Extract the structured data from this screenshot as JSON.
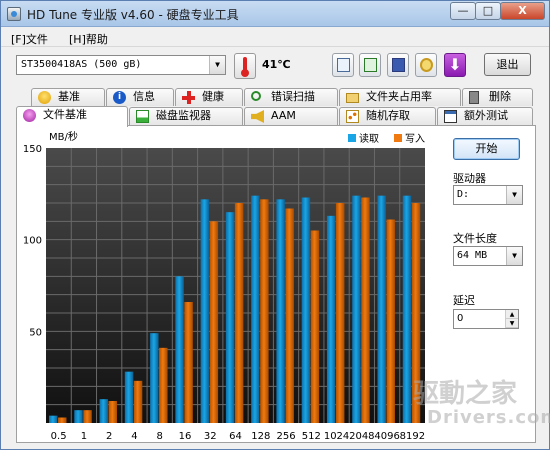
{
  "window": {
    "title": "HD Tune 专业版 v4.60 - 硬盘专业工具",
    "min_label": "—",
    "max_label": "□",
    "close_label": "X"
  },
  "menu": {
    "file": "[F]文件",
    "help": "[H]帮助"
  },
  "toolbar": {
    "drive": "ST3500418AS (500 gB)",
    "temperature": "41℃",
    "exit_label": "退出",
    "download_glyph": "⬇"
  },
  "tabs": {
    "row1": [
      "基准",
      "信息",
      "健康",
      "错误扫描",
      "文件夹占用率",
      "删除"
    ],
    "row2": [
      "文件基准",
      "磁盘监视器",
      "AAM",
      "随机存取",
      "额外测试"
    ],
    "active": "文件基准"
  },
  "side": {
    "start_label": "开始",
    "drive_label": "驱动器",
    "drive_value": "D:",
    "length_label": "文件长度",
    "length_value": "64 MB",
    "delay_label": "延迟",
    "delay_value": "0"
  },
  "colors": {
    "read": "#1aa6e6",
    "write": "#f07a10",
    "background_top": "#4a4a4a",
    "background_bottom": "#101010"
  },
  "chart_data": {
    "type": "bar",
    "ylabel": "MB/秒",
    "ylim": [
      0,
      150
    ],
    "yticks": [
      50,
      100,
      150
    ],
    "categories": [
      "0.5",
      "1",
      "2",
      "4",
      "8",
      "16",
      "32",
      "64",
      "128",
      "256",
      "512",
      "1024",
      "2048",
      "4096",
      "8192"
    ],
    "series": [
      {
        "name": "读取",
        "values": [
          4,
          7,
          13,
          28,
          49,
          80,
          122,
          115,
          124,
          122,
          123,
          113,
          124,
          124,
          124
        ]
      },
      {
        "name": "写入",
        "values": [
          3,
          7,
          12,
          23,
          41,
          66,
          110,
          120,
          122,
          117,
          105,
          120,
          123,
          111,
          120
        ]
      }
    ],
    "grid": true,
    "legend": "top-right"
  },
  "watermark": {
    "line1": "驱動之家",
    "line2": "Drivers.com"
  }
}
